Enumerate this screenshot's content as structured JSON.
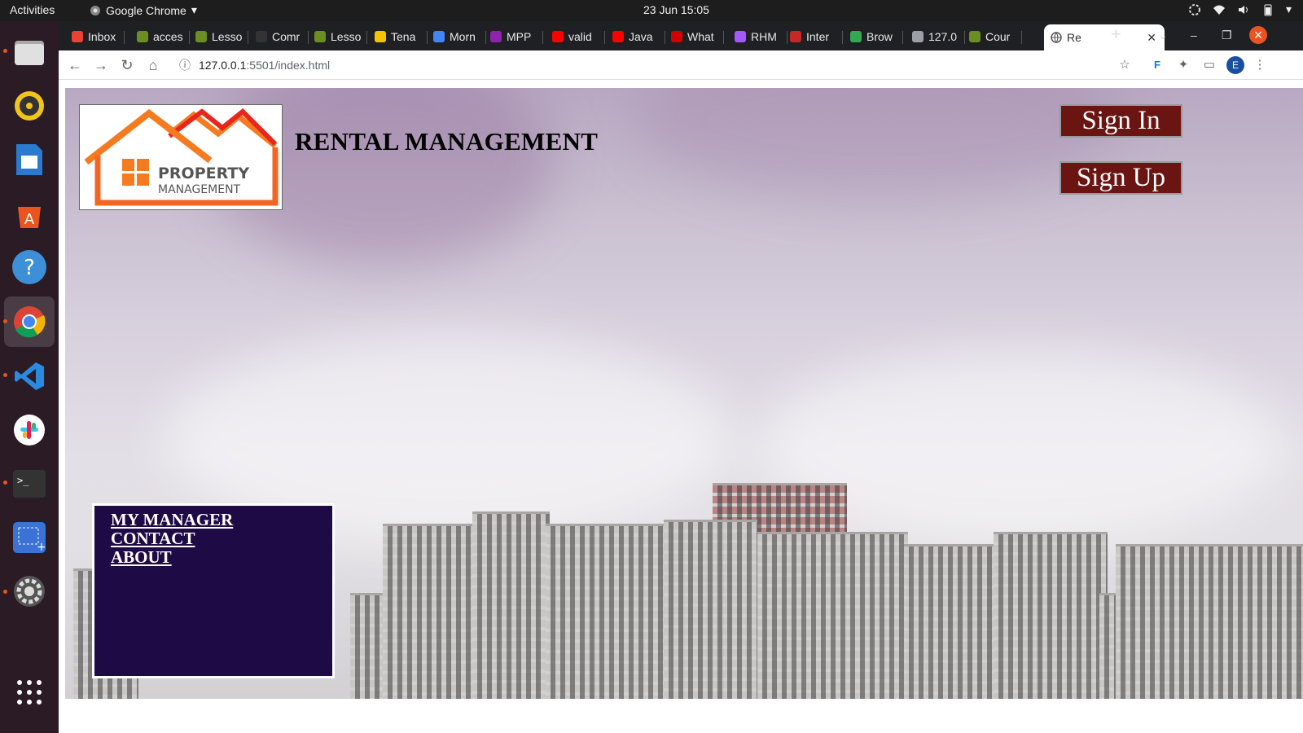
{
  "os": {
    "activities": "Activities",
    "app_name": "Google Chrome",
    "clock": "23 Jun  15:05"
  },
  "browser": {
    "tabs": [
      {
        "label": "Inbox",
        "color": "#ea4335"
      },
      {
        "label": "acces",
        "color": "#6b8e23"
      },
      {
        "label": "Lesso",
        "color": "#6b8e23"
      },
      {
        "label": "Comr",
        "color": "#333333"
      },
      {
        "label": "Lesso",
        "color": "#6b8e23"
      },
      {
        "label": "Tena",
        "color": "#f5c400"
      },
      {
        "label": "Morn",
        "color": "#4285f4"
      },
      {
        "label": "MPP",
        "color": "#8e24aa"
      },
      {
        "label": "valid",
        "color": "#ff0000"
      },
      {
        "label": "Java",
        "color": "#ff0000"
      },
      {
        "label": "What",
        "color": "#d50000"
      },
      {
        "label": "RHM",
        "color": "#a259ff"
      },
      {
        "label": "Inter",
        "color": "#c62828"
      },
      {
        "label": "Brow",
        "color": "#34a853"
      },
      {
        "label": "127.0",
        "color": "#9aa0a6"
      },
      {
        "label": "Cour",
        "color": "#6b8e23"
      }
    ],
    "active_tab": {
      "label": "Re",
      "close": "✕"
    },
    "new_tab": "+",
    "url_host": "127.0.0.1",
    "url_path": ":5501/index.html",
    "profile_initial": "E"
  },
  "page": {
    "logo": {
      "line1": "PROPERTY",
      "line2": "MANAGEMENT"
    },
    "title": "RENTAL MANAGEMENT",
    "sign_in": "Sign In",
    "sign_up": "Sign Up",
    "nav": [
      "MY MANAGER",
      "CONTACT",
      "ABOUT"
    ],
    "colors": {
      "button_bg": "#6b1512",
      "nav_box_bg": "#1e0a45",
      "logo_orange": "#f47b20",
      "logo_red": "#e8261c"
    }
  }
}
